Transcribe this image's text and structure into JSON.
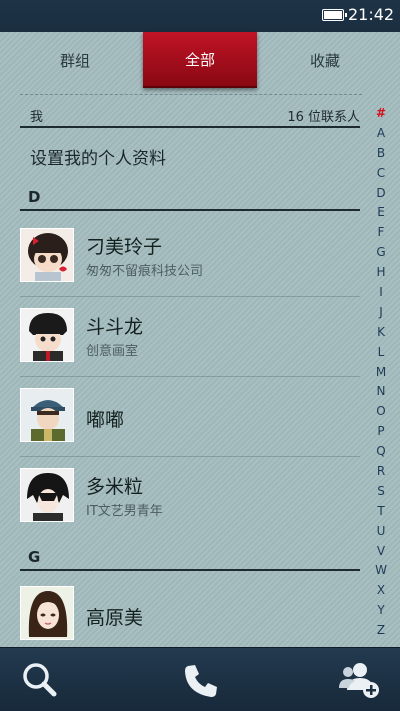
{
  "status_bar": {
    "time": "21:42",
    "battery_icon": "battery-full-icon"
  },
  "tabs": [
    {
      "label": "群组",
      "active": false
    },
    {
      "label": "全部",
      "active": true
    },
    {
      "label": "收藏",
      "active": false
    }
  ],
  "me_section": {
    "label": "我",
    "contact_count": "16 位联系人",
    "setup_profile": "设置我的个人资料"
  },
  "sections": [
    {
      "letter": "D",
      "contacts": [
        {
          "name": "刁美玲子",
          "subtitle": "匆匆不留痕科技公司"
        },
        {
          "name": "斗斗龙",
          "subtitle": "创意画室"
        },
        {
          "name": "嘟嘟",
          "subtitle": ""
        },
        {
          "name": "多米粒",
          "subtitle": "IT文艺男青年"
        }
      ]
    },
    {
      "letter": "G",
      "contacts": [
        {
          "name": "高原美",
          "subtitle": ""
        }
      ]
    }
  ],
  "alphabet_index": [
    "#",
    "A",
    "B",
    "C",
    "D",
    "E",
    "F",
    "G",
    "H",
    "I",
    "J",
    "K",
    "L",
    "M",
    "N",
    "O",
    "P",
    "Q",
    "R",
    "S",
    "T",
    "U",
    "V",
    "W",
    "X",
    "Y",
    "Z"
  ],
  "bottom_bar": {
    "search_icon": "search-icon",
    "call_icon": "phone-icon",
    "add_contact_icon": "add-contact-icon"
  },
  "colors": {
    "accent_red": "#b00f1f",
    "panel_bg": "#a4bcbf",
    "bar_bg": "#1f3447"
  }
}
